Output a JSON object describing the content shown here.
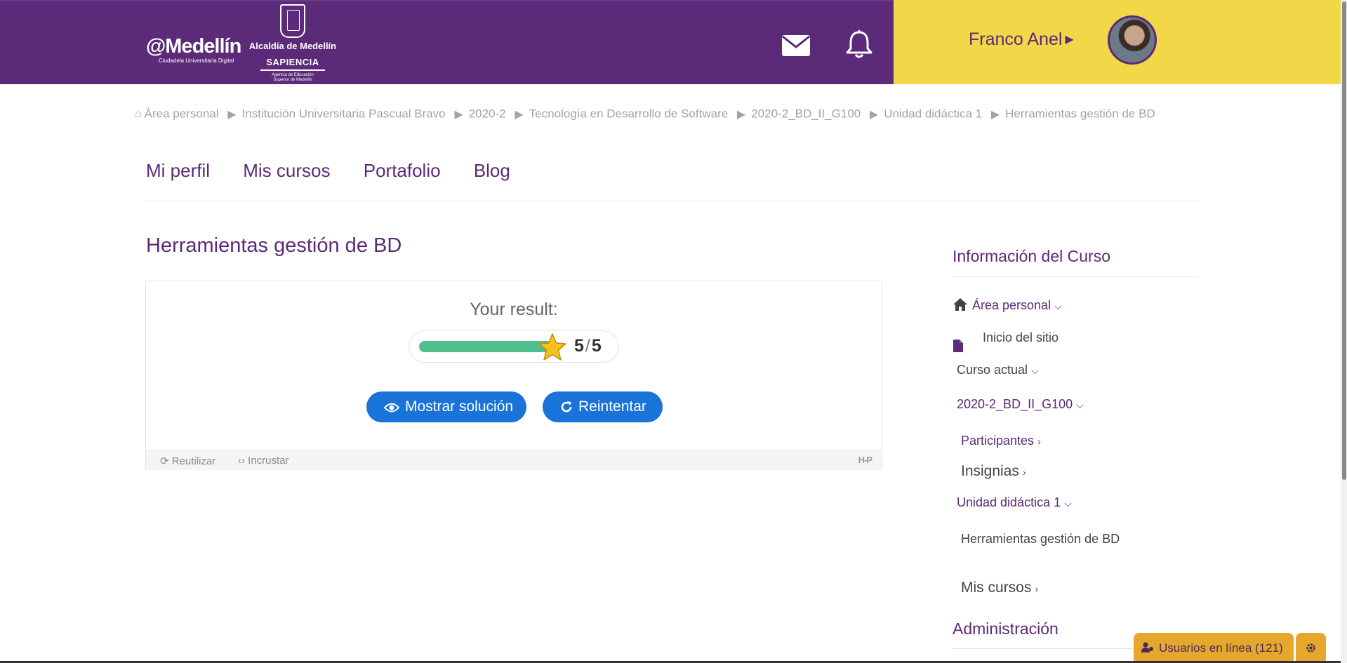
{
  "header": {
    "logo_main": "@Medellín",
    "logo_tagline": "Ciudadela Universitaria Digital",
    "alcaldia": "Alcaldía de Medellín",
    "sapiencia": "SAPIENCIA",
    "sapiencia_sub_1": "Agencia de Educación",
    "sapiencia_sub_2": "Superior de Medellín",
    "user_name": "Franco Anel",
    "colors": {
      "brand_purple": "#5b2a78",
      "user_panel_yellow": "#f2d749"
    }
  },
  "breadcrumb": [
    "Área personal",
    "Institución Universitaria Pascual Bravo",
    "2020-2",
    "Tecnología en Desarrollo de Software",
    "2020-2_BD_II_G100",
    "Unidad didáctica 1",
    "Herramientas gestión de BD"
  ],
  "nav": [
    "Mi perfil",
    "Mis cursos",
    "Portafolio",
    "Blog"
  ],
  "main": {
    "title": "Herramientas gestión de BD",
    "result_label": "Your result:",
    "score": 5,
    "score_max": 5,
    "score_fraction": 1.0,
    "show_solution": "Mostrar solución",
    "retry": "Reintentar",
    "reuse": "Reutilizar",
    "embed": "Incrustar",
    "h5p_logo": "H-P"
  },
  "sidebar": {
    "title": "Información del Curso",
    "home": "Área personal",
    "inicio": "Inicio del sitio",
    "curso_actual": "Curso actual",
    "course": "2020-2_BD_II_G100",
    "participantes": "Participantes",
    "insignias": "Insignias",
    "unidad": "Unidad didáctica 1",
    "current_page": "Herramientas gestión de BD",
    "mis_cursos": "Mis cursos",
    "admin": "Administración"
  },
  "online": {
    "label": "Usuarios en línea (121)"
  }
}
